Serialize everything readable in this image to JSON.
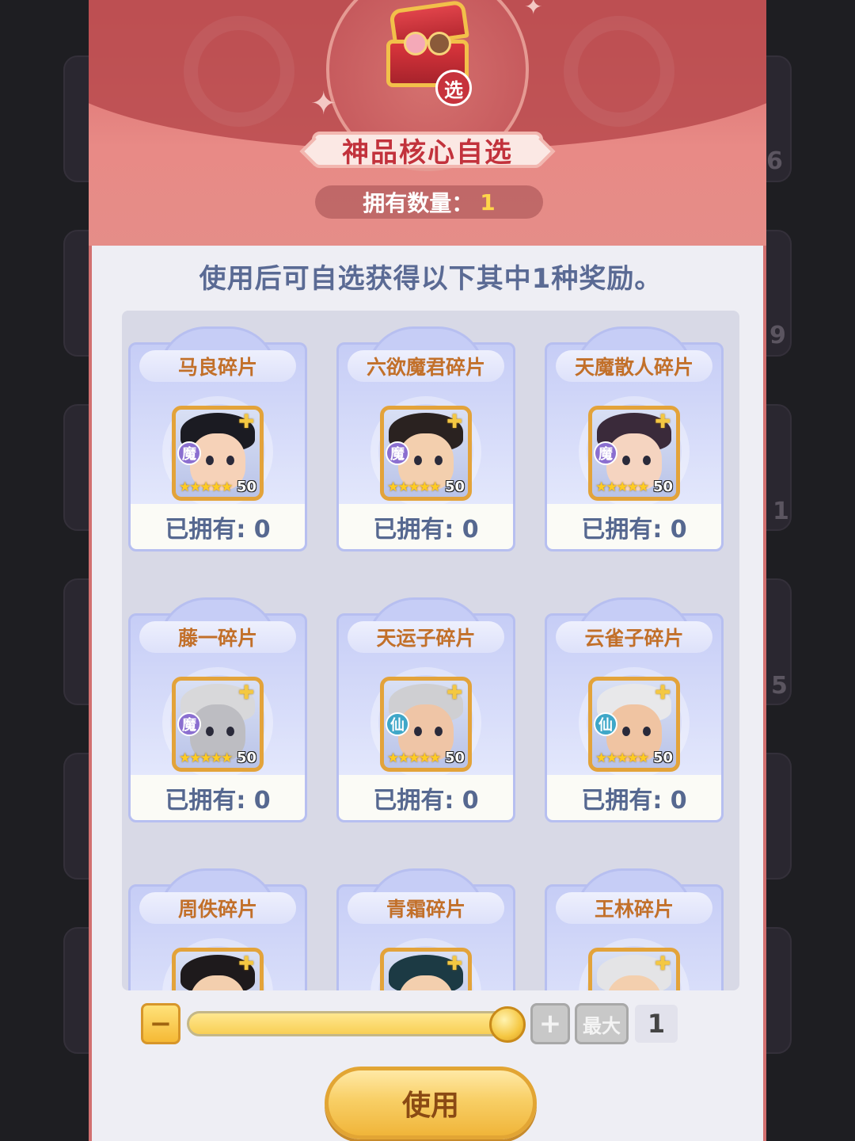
{
  "dialog": {
    "item_name": "神品核心自选",
    "select_badge": "选",
    "owned_label": "拥有数量：",
    "owned_count": "1",
    "description": "使用后可自选获得以下其中1种奖励。"
  },
  "rewards": [
    {
      "name": "马良碎片",
      "faction": "魔",
      "faction_color": "#8b6fd0",
      "level": "50",
      "stars": "★★★★★",
      "owned": "已拥有: 0",
      "hair": "#1b1b22",
      "skin": "#f6d2b8"
    },
    {
      "name": "六欲魔君碎片",
      "faction": "魔",
      "faction_color": "#8b6fd0",
      "level": "50",
      "stars": "★★★★★",
      "owned": "已拥有: 0",
      "hair": "#2a2220",
      "skin": "#f3cfae"
    },
    {
      "name": "天魔散人碎片",
      "faction": "魔",
      "faction_color": "#8b6fd0",
      "level": "50",
      "stars": "★★★★★",
      "owned": "已拥有: 0",
      "hair": "#3a2a3a",
      "skin": "#f5d4c0"
    },
    {
      "name": "藤一碎片",
      "faction": "魔",
      "faction_color": "#8b6fd0",
      "level": "50",
      "stars": "★★★★★",
      "owned": "已拥有: 0",
      "hair": "#d8d8da",
      "skin": "#bdbdc2"
    },
    {
      "name": "天运子碎片",
      "faction": "仙",
      "faction_color": "#3fa7c8",
      "level": "50",
      "stars": "★★★★★",
      "owned": "已拥有: 0",
      "hair": "#cfcfd2",
      "skin": "#efc5a6"
    },
    {
      "name": "云雀子碎片",
      "faction": "仙",
      "faction_color": "#3fa7c8",
      "level": "50",
      "stars": "★★★★★",
      "owned": "已拥有: 0",
      "hair": "#e8e8ea",
      "skin": "#f0c4a2"
    },
    {
      "name": "周佚碎片",
      "hair": "#1e1a1c",
      "skin": "#f3cfae"
    },
    {
      "name": "青霜碎片",
      "hair": "#1c3a44",
      "skin": "#f3cfae"
    },
    {
      "name": "王林碎片",
      "hair": "#e4e4e6",
      "skin": "#f3cfae"
    }
  ],
  "controls": {
    "minus_label": "−",
    "plus_label": "+",
    "max_label": "最大",
    "quantity": "1",
    "slider_fraction": 1.0,
    "use_label": "使用"
  },
  "background": {
    "visible_numbers": [
      "6",
      "9",
      "1",
      "5"
    ]
  }
}
